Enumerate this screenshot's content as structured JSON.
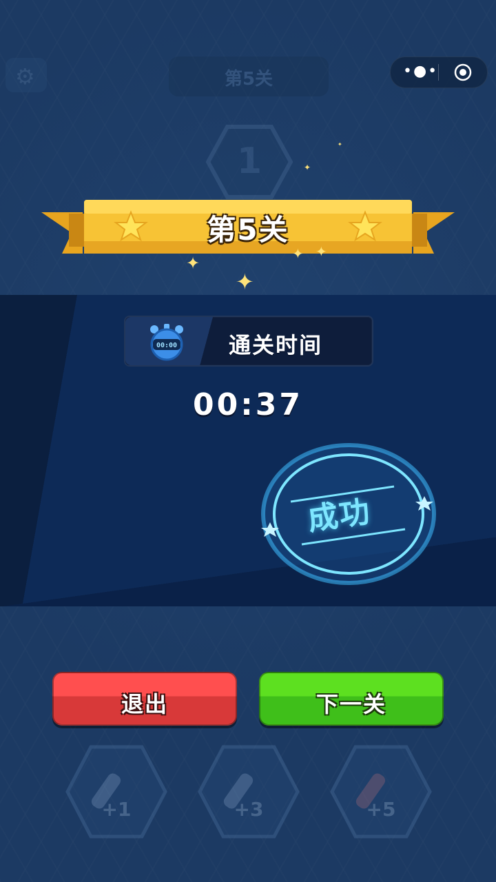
{
  "header": {
    "level_title_dim": "第5关",
    "more_icon": "more-dots-icon",
    "target_icon": "target-icon",
    "settings_icon": "gear-icon"
  },
  "background": {
    "level_number": "1"
  },
  "result": {
    "banner_title": "第5关",
    "time_label": "通关时间",
    "stopwatch_display": "00:00",
    "time_value": "00:37",
    "stamp_text": "成功"
  },
  "buttons": {
    "exit_label": "退出",
    "next_label": "下一关"
  },
  "powerups": [
    {
      "count": "+1"
    },
    {
      "count": "+3"
    },
    {
      "count": "+5"
    }
  ],
  "colors": {
    "banner_gold": "#f7c335",
    "exit_red": "#e24343",
    "next_green": "#4fcf1c",
    "stamp_cyan": "#5fe4ff"
  }
}
